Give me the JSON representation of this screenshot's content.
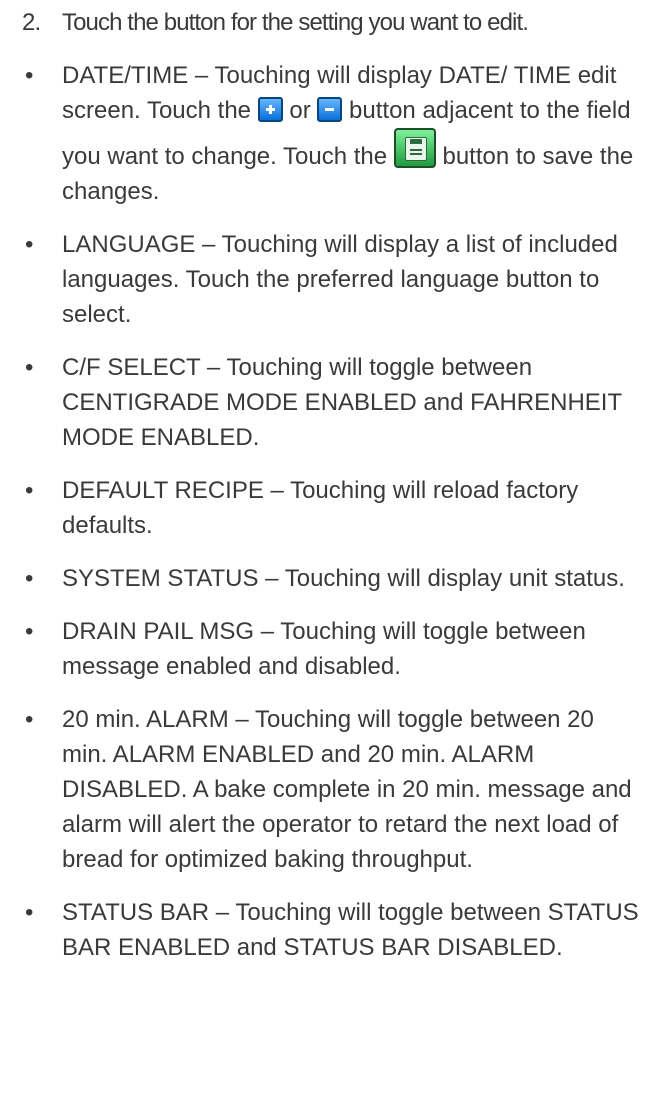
{
  "step": {
    "number": "2.",
    "text": "Touch the button for the setting you want to edit."
  },
  "bullet_glyph": "•",
  "items": [
    {
      "parts": [
        "DATE/TIME – Touching will display DATE/ TIME edit screen.  Touch the ",
        " or ",
        " button adjacent to the field you want to change. Touch the ",
        " button to save the changes."
      ],
      "icons": [
        "plus-icon",
        "minus-icon",
        "save-icon"
      ]
    },
    {
      "text": "LANGUAGE – Touching will display a list of included languages.  Touch the preferred language button to select."
    },
    {
      "text": "C/F SELECT – Touching will toggle between CENTIGRADE MODE ENABLED and FAHRENHEIT MODE ENABLED."
    },
    {
      "text": "DEFAULT RECIPE – Touching will reload factory defaults."
    },
    {
      "text": "SYSTEM STATUS – Touching will display unit status."
    },
    {
      "text": "DRAIN PAIL MSG – Touching will toggle between message enabled and disabled."
    },
    {
      "text": "20 min. ALARM – Touching will toggle between 20 min. ALARM ENABLED and 20 min. ALARM DISABLED.  A bake complete in 20 min. message and alarm will alert the operator to retard the next load of bread for optimized baking throughput."
    },
    {
      "text": "STATUS BAR – Touching will toggle between STATUS BAR ENABLED and STATUS BAR DISABLED."
    }
  ],
  "colors": {
    "text": "#3a3a3a",
    "plus_minus_button": "#0a6fd8",
    "save_button": "#1f9b3c"
  }
}
